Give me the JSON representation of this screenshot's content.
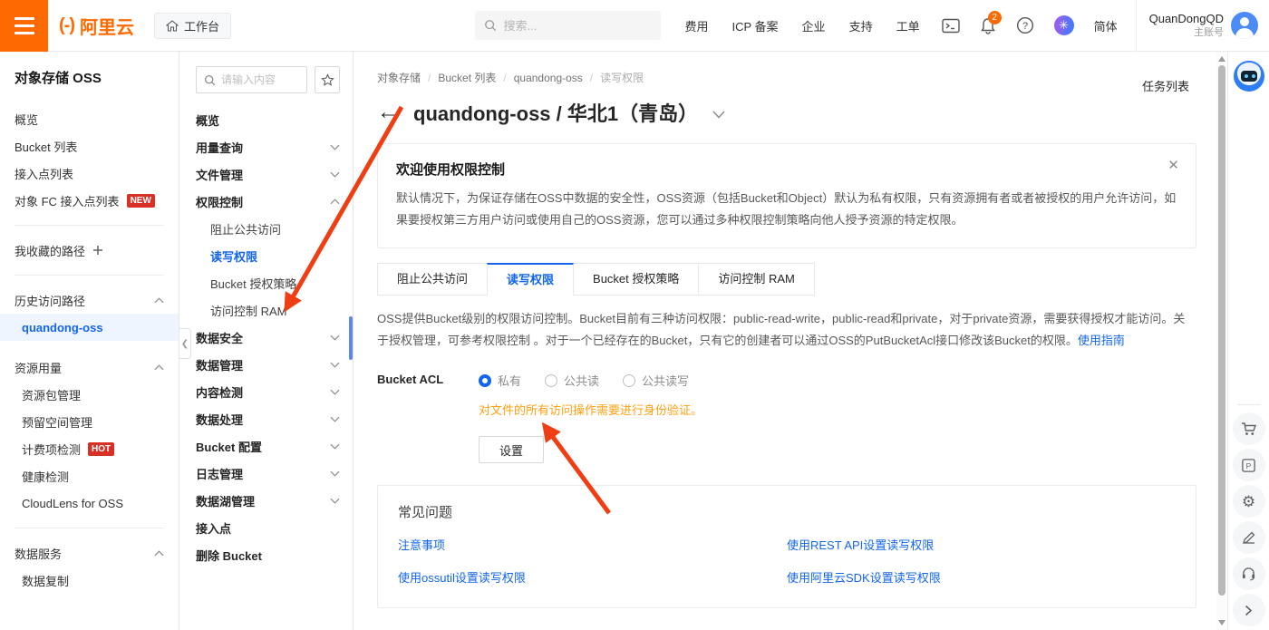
{
  "colors": {
    "brand_orange": "#FF6A00",
    "link_blue": "#1366EC",
    "badge_red": "#D93026",
    "warning_orange": "#FFA011",
    "arrow_red": "#F03E14"
  },
  "topbar": {
    "logo_text": "阿里云",
    "workbench_label": "工作台",
    "search_placeholder": "搜索...",
    "nav_items": [
      "费用",
      "ICP 备案",
      "企业",
      "支持",
      "工单"
    ],
    "notification_count": "2",
    "language": "简体",
    "account": {
      "name": "QuanDongQD",
      "type": "主账号"
    }
  },
  "sidebar": {
    "title": "对象存储 OSS",
    "items": [
      {
        "label": "概览"
      },
      {
        "label": "Bucket 列表"
      },
      {
        "label": "接入点列表"
      },
      {
        "label": "对象 FC 接入点列表",
        "badge": "NEW"
      }
    ],
    "favorites": {
      "label": "我收藏的路径"
    },
    "history": {
      "label": "历史访问路径",
      "items": [
        {
          "label": "quandong-oss",
          "selected": true
        }
      ]
    },
    "usage": {
      "label": "资源用量",
      "items": [
        {
          "label": "资源包管理"
        },
        {
          "label": "预留空间管理"
        },
        {
          "label": "计费项检测",
          "badge": "HOT"
        },
        {
          "label": "健康检测"
        },
        {
          "label": "CloudLens for OSS"
        }
      ]
    },
    "data_service": {
      "label": "数据服务",
      "items": [
        {
          "label": "数据复制"
        }
      ]
    }
  },
  "bucket_menu": {
    "search_placeholder": "请输入内容",
    "items": [
      {
        "label": "概览"
      },
      {
        "label": "用量查询"
      },
      {
        "label": "文件管理"
      },
      {
        "label": "权限控制",
        "children": [
          {
            "label": "阻止公共访问"
          },
          {
            "label": "读写权限",
            "active": true
          },
          {
            "label": "Bucket 授权策略"
          },
          {
            "label": "访问控制 RAM"
          }
        ]
      },
      {
        "label": "数据安全"
      },
      {
        "label": "数据管理"
      },
      {
        "label": "内容检测"
      },
      {
        "label": "数据处理"
      },
      {
        "label": "Bucket 配置"
      },
      {
        "label": "日志管理"
      },
      {
        "label": "数据湖管理"
      },
      {
        "label": "接入点"
      },
      {
        "label": "删除 Bucket"
      }
    ]
  },
  "main": {
    "breadcrumb": [
      "对象存储",
      "Bucket 列表",
      "quandong-oss",
      "读写权限"
    ],
    "title": "quandong-oss / 华北1（青岛）",
    "task_list_label": "任务列表",
    "welcome": {
      "title": "欢迎使用权限控制",
      "body": "默认情况下，为保证存储在OSS中数据的安全性，OSS资源（包括Bucket和Object）默认为私有权限，只有资源拥有者或者被授权的用户允许访问，如果要授权第三方用户访问或使用自己的OSS资源，您可以通过多种权限控制策略向他人授予资源的特定权限。"
    },
    "tabs": [
      {
        "label": "阻止公共访问"
      },
      {
        "label": "读写权限",
        "active": true
      },
      {
        "label": "Bucket 授权策略"
      },
      {
        "label": "访问控制 RAM"
      }
    ],
    "description": "OSS提供Bucket级别的权限访问控制。Bucket目前有三种访问权限：public-read-write，public-read和private，对于private资源，需要获得授权才能访问。关于授权管理，可参考权限控制 。对于一个已经存在的Bucket，只有它的创建者可以通过OSS的PutBucketAcl接口修改该Bucket的权限。",
    "guide_link": "使用指南",
    "acl": {
      "label": "Bucket ACL",
      "options": [
        {
          "label": "私有",
          "selected": true
        },
        {
          "label": "公共读"
        },
        {
          "label": "公共读写"
        }
      ],
      "warning": "对文件的所有访问操作需要进行身份验证。",
      "submit_label": "设置"
    },
    "faq": {
      "title": "常见问题",
      "links": [
        "注意事项",
        "使用REST API设置读写权限",
        "使用ossutil设置读写权限",
        "使用阿里云SDK设置读写权限"
      ]
    }
  }
}
